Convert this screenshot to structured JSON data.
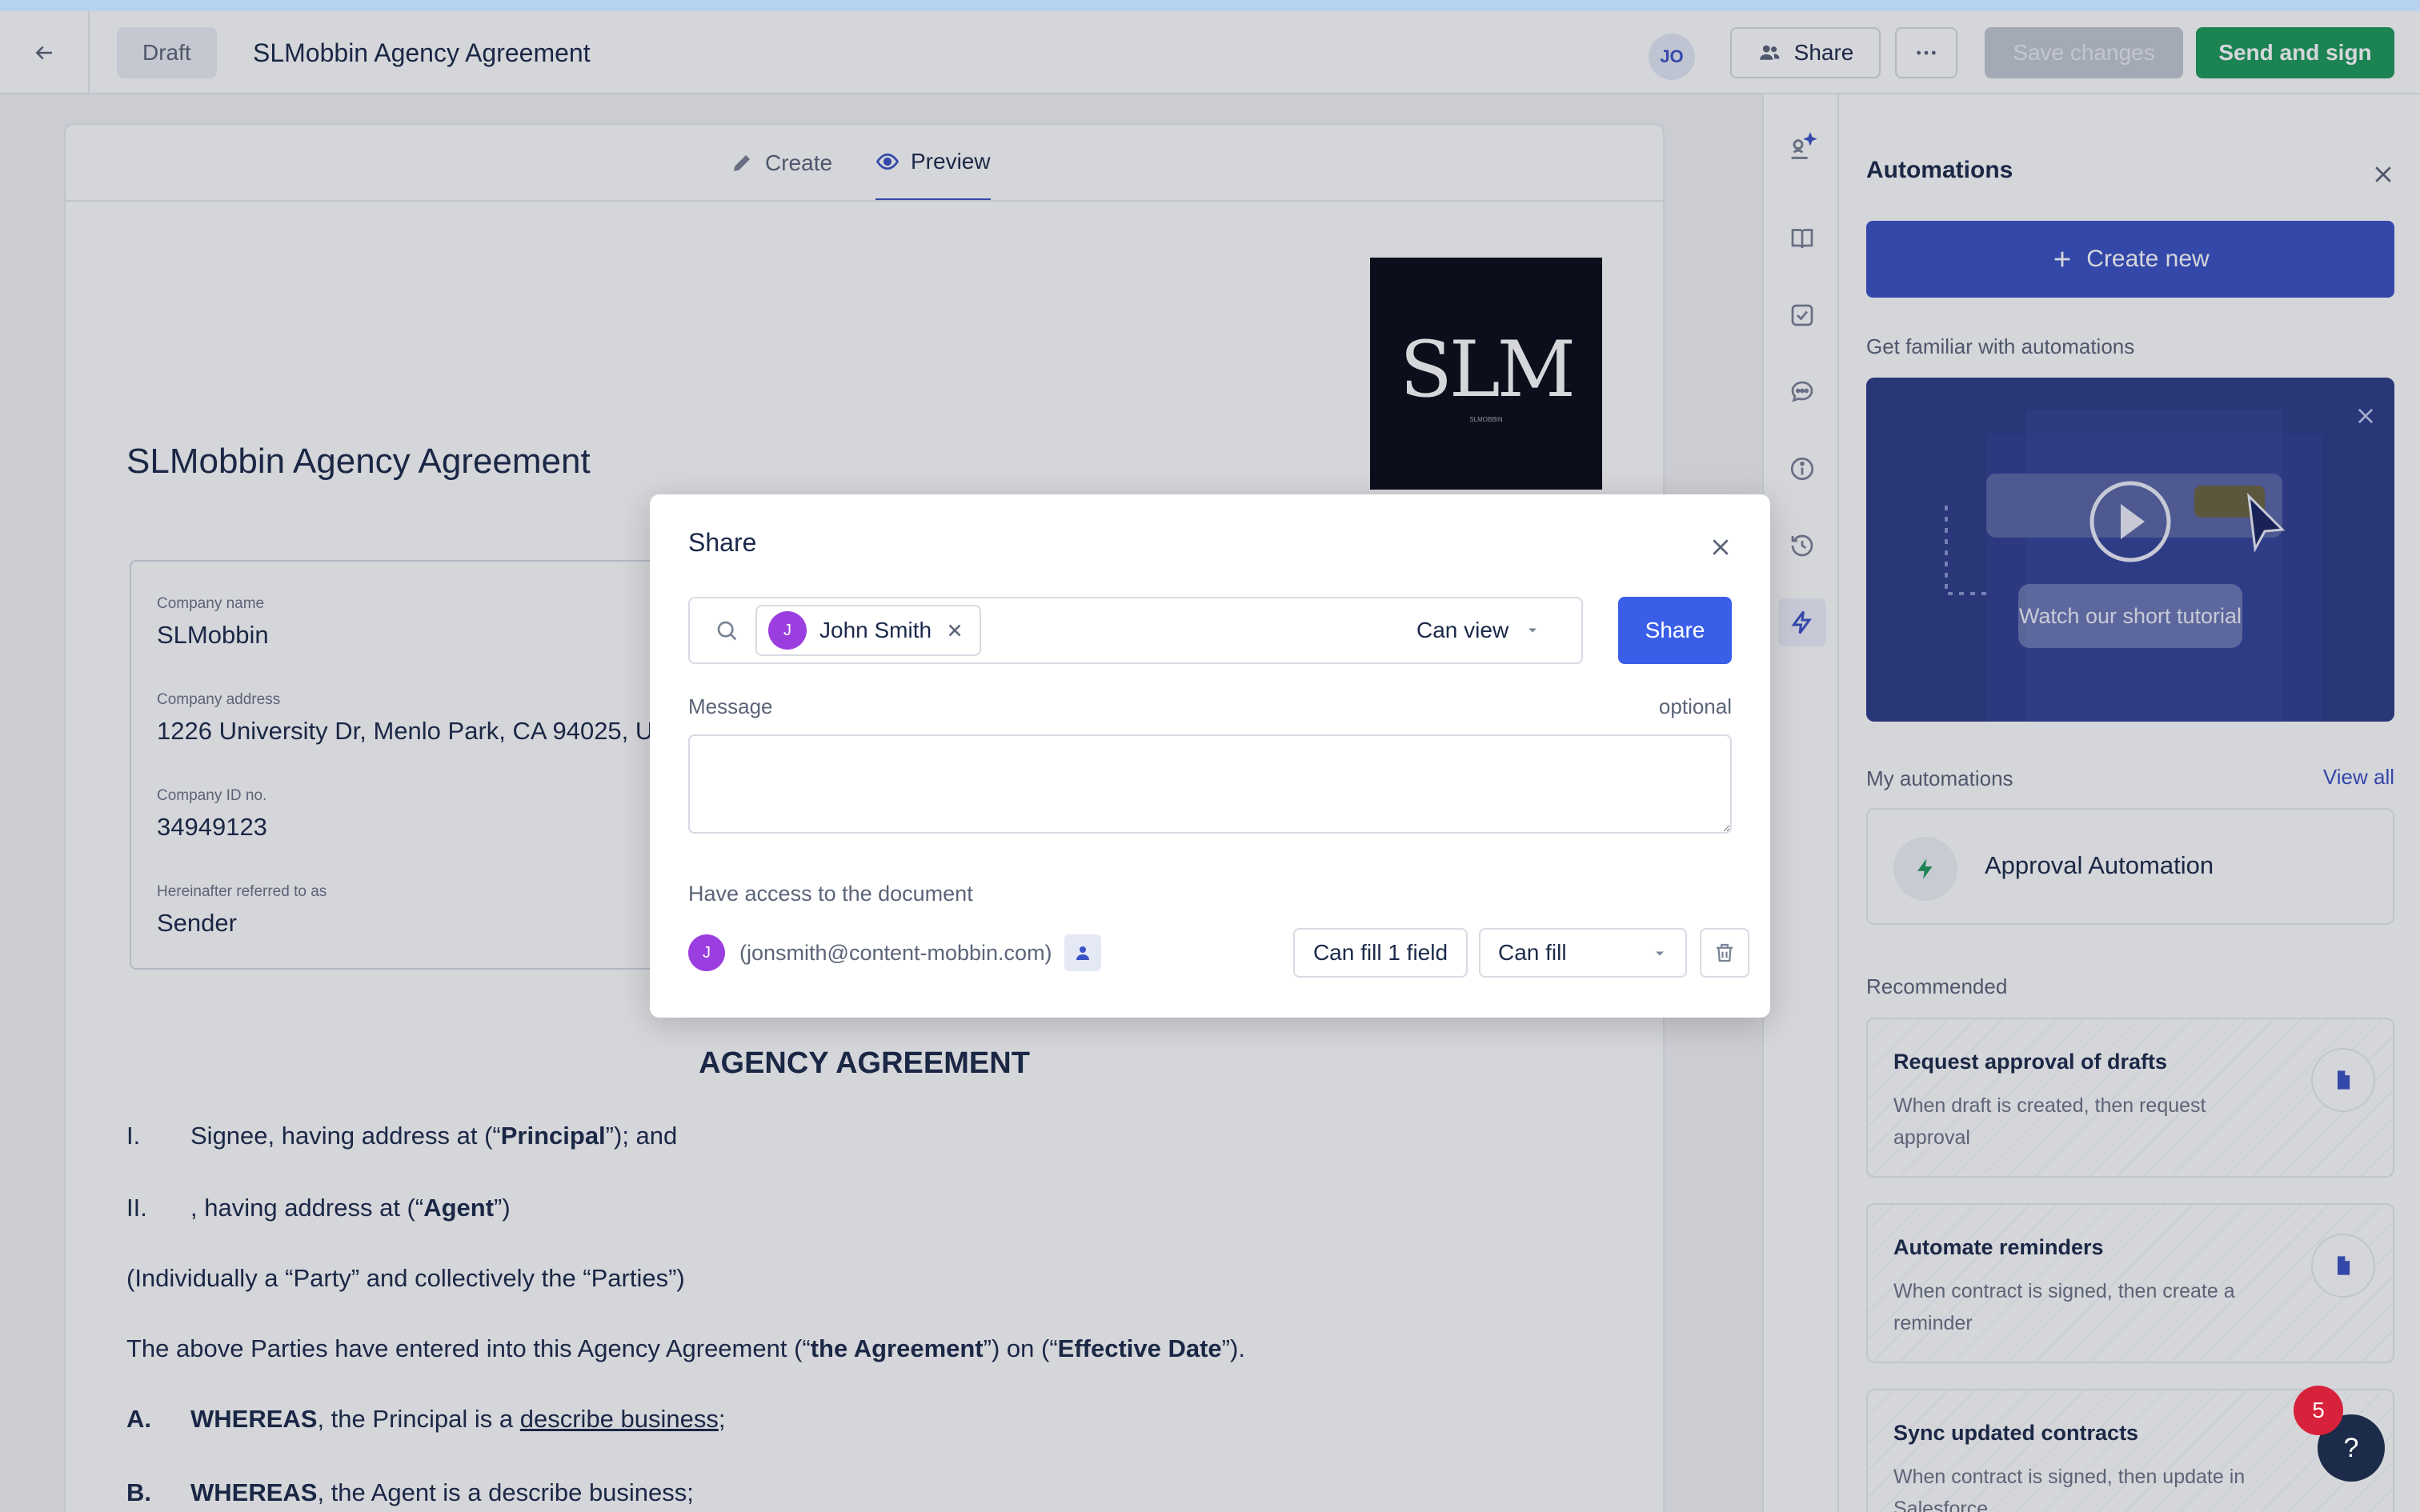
{
  "header": {
    "draft_label": "Draft",
    "document_title": "SLMobbin Agency Agreement",
    "avatar_initials": "JO",
    "share_label": "Share",
    "save_label": "Save changes",
    "send_label": "Send and sign"
  },
  "tabs": [
    {
      "label": "Create",
      "icon": "pencil-icon",
      "active": false
    },
    {
      "label": "Preview",
      "icon": "eye-icon",
      "active": true
    }
  ],
  "document": {
    "logo_text": "SLM",
    "logo_subtext": "SLMOBBIN",
    "title": "SLMobbin Agency Agreement",
    "fields": [
      {
        "label": "Company name",
        "value": "SLMobbin"
      },
      {
        "label": "Company address",
        "value": "1226 University Dr, Menlo Park, CA 94025, U"
      },
      {
        "label": "Company ID no.",
        "value": "34949123"
      },
      {
        "label": "Hereinafter referred to as",
        "value": "Sender"
      }
    ],
    "agreement_heading": "AGENCY AGREEMENT",
    "clause_1_num": "I.",
    "clause_1_pre": "Signee, having address at  (“",
    "clause_1_bold": "Principal",
    "clause_1_post": "”); and",
    "clause_2_num": "II.",
    "clause_2_pre": ", having address at  (“",
    "clause_2_bold": "Agent",
    "clause_2_post": "”)",
    "individually": "(Individually a “Party” and collectively the “Parties”)",
    "entered_pre": "The above Parties have entered into this Agency Agreement (“",
    "entered_bold1": "the Agreement",
    "entered_mid": "”) on  (“",
    "entered_bold2": "Effective Date",
    "entered_post": "”).",
    "whereas_a_num": "A.",
    "whereas_a_bold": "WHEREAS",
    "whereas_a_text": ", the Principal is a ",
    "whereas_a_link": "describe business",
    "whereas_a_end": ";",
    "whereas_b_num": "B.",
    "whereas_b_bold": "WHEREAS",
    "whereas_b_text": ", the Agent is a describe business;"
  },
  "rail_icons": [
    "sparkle-signature-icon",
    "book-icon",
    "checkbox-icon",
    "comment-icon",
    "info-icon",
    "history-icon",
    "lightning-icon"
  ],
  "panel": {
    "title": "Automations",
    "create_new": "Create new",
    "familiar": "Get familiar with automations",
    "tutorial_label": "Watch our short tutorial",
    "my_automations": "My automations",
    "view_all": "View all",
    "approval_automation": "Approval Automation",
    "recommended": "Recommended",
    "rec_cards": [
      {
        "title": "Request approval of drafts",
        "desc": "When draft is created, then request approval"
      },
      {
        "title": "Automate reminders",
        "desc": "When contract is signed, then create a reminder"
      },
      {
        "title": "Sync updated contracts",
        "desc": "When contract is signed, then update in Salesforce"
      }
    ]
  },
  "help": {
    "label": "?",
    "badge_count": "5"
  },
  "modal": {
    "title": "Share",
    "recipient_initial": "J",
    "recipient_name": "John Smith",
    "permission": "Can view",
    "share_button": "Share",
    "message_label": "Message",
    "message_optional": "optional",
    "message_value": "",
    "access_label": "Have access to the document",
    "access_initial": "J",
    "access_email": "(jonsmith@content-mobbin.com)",
    "fill_fields_button": "Can fill 1 field",
    "access_permission": "Can fill"
  },
  "colors": {
    "accent": "#3b52c4",
    "share_button": "#3b5ee8",
    "send_button": "#1e9a5a",
    "avatar": "#9b3ee0",
    "badge": "#d8213a",
    "tutorial_bg": "#2e3c88"
  }
}
